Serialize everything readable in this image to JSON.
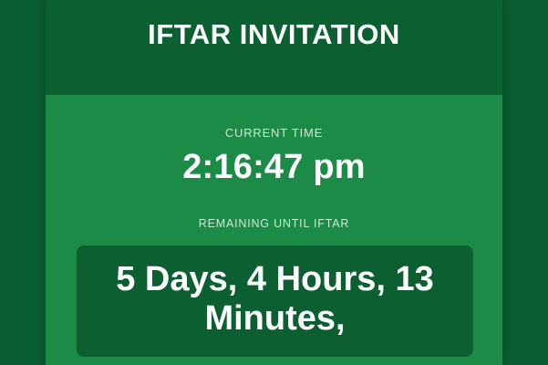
{
  "header": {
    "title": "IFTAR INVITATION"
  },
  "current_time": {
    "label": "CURRENT TIME",
    "value": "2:16:47 pm"
  },
  "remaining": {
    "label": "REMAINING UNTIL IFTAR",
    "value": "5 Days, 4 Hours, 13 Minutes,"
  },
  "colors": {
    "background_dark_green": "#0a5d30",
    "card_green": "#1b8b47",
    "header_green": "#0b5f31",
    "text_white": "#ffffff",
    "muted_label": "#cde8d6"
  }
}
